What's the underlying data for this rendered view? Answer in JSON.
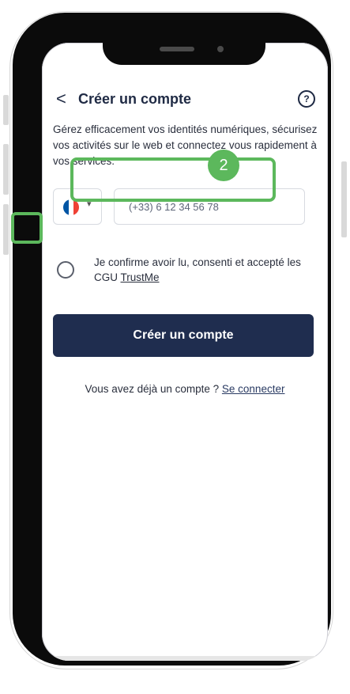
{
  "header": {
    "back_icon": "chevron-left",
    "back_label": "<",
    "title": "Créer un compte",
    "help_icon": "help-circle",
    "help_label": "?"
  },
  "description": "Gérez efficacement vos identités numériques, sécurisez vos activités sur le web et connectez vous rapidement à vos services.",
  "phone": {
    "country_flag": "france-flag",
    "flag_colors": [
      "#0055A4",
      "#FFFFFF",
      "#EF4135"
    ],
    "caret": "▾",
    "placeholder": "(+33) 6 12 34 56 78"
  },
  "step_marker": "2",
  "consent": {
    "text_before": "Je confirme avoir lu, consenti et accepté les CGU ",
    "link": "TrustMe"
  },
  "cta_label": "Créer un compte",
  "login": {
    "text": "Vous avez déjà un compte ? ",
    "link": "Se connecter"
  },
  "colors": {
    "primary": "#1f2d4f",
    "highlight": "#5cb85c"
  }
}
